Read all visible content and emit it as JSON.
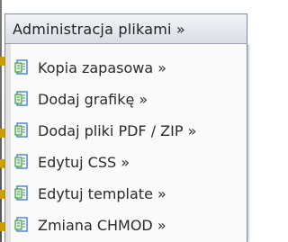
{
  "menu": {
    "header_label": "Administracja plikami »",
    "items": [
      {
        "label": "Kopia zapasowa »",
        "icon": "document-icon"
      },
      {
        "label": "Dodaj grafikę »",
        "icon": "document-icon"
      },
      {
        "label": "Dodaj pliki PDF / ZIP »",
        "icon": "document-icon"
      },
      {
        "label": "Edytuj CSS »",
        "icon": "document-icon"
      },
      {
        "label": "Edytuj template »",
        "icon": "document-icon"
      },
      {
        "label": "Zmiana CHMOD »",
        "icon": "document-icon"
      }
    ]
  },
  "colors": {
    "header_bg_top": "#f2f4f8",
    "header_bg_bottom": "#d9dde4",
    "border": "#7f8da4",
    "text": "#2a2a2a",
    "icon_blue": "#3a76c4",
    "icon_green": "#3e9e3e"
  }
}
